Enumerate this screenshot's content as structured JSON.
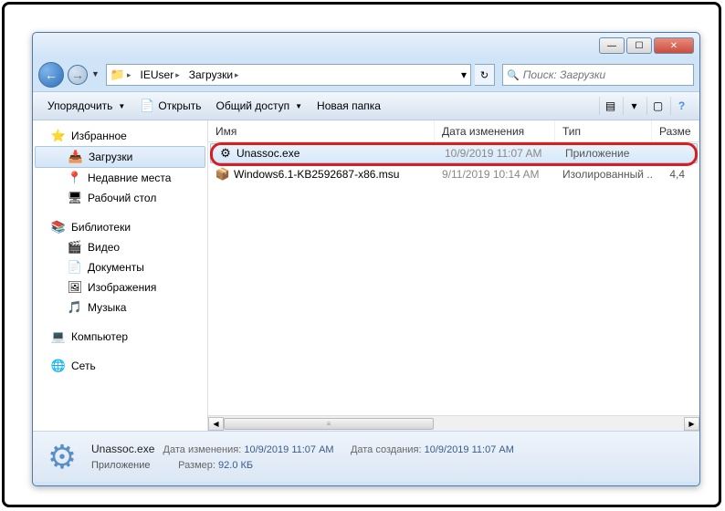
{
  "titlebar": {
    "min": "—",
    "max": "☐",
    "close": "✕"
  },
  "nav": {
    "back": "←",
    "fwd": "→",
    "drop": "▼",
    "refresh": "↻"
  },
  "breadcrumb": {
    "root_icon": "📁",
    "seg1": "IEUser",
    "seg2": "Загрузки",
    "arrow": "▸",
    "end_drop": "▾"
  },
  "search": {
    "icon": "🔍",
    "placeholder": "Поиск: Загрузки"
  },
  "toolbar": {
    "organize": "Упорядочить",
    "open_icon": "📄",
    "open": "Открыть",
    "share": "Общий доступ",
    "new_folder": "Новая папка",
    "view1": "▤",
    "view2": "▾",
    "preview": "▢",
    "help": "?"
  },
  "sidebar": {
    "favorites": {
      "icon": "⭐",
      "label": "Избранное"
    },
    "downloads": {
      "icon": "📥",
      "label": "Загрузки"
    },
    "recent": {
      "icon": "📍",
      "label": "Недавние места"
    },
    "desktop": {
      "icon": "🖥",
      "label": "Рабочий стол"
    },
    "libraries": {
      "icon": "📚",
      "label": "Библиотеки"
    },
    "videos": {
      "icon": "🎬",
      "label": "Видео"
    },
    "documents": {
      "icon": "📄",
      "label": "Документы"
    },
    "pictures": {
      "icon": "🖼",
      "label": "Изображения"
    },
    "music": {
      "icon": "🎵",
      "label": "Музыка"
    },
    "computer": {
      "icon": "💻",
      "label": "Компьютер"
    },
    "network": {
      "icon": "🌐",
      "label": "Сеть"
    }
  },
  "columns": {
    "name": "Имя",
    "date": "Дата изменения",
    "type": "Тип",
    "size": "Разме"
  },
  "files": [
    {
      "icon": "⚙",
      "name": "Unassoc.exe",
      "date": "10/9/2019 11:07 AM",
      "type": "Приложение",
      "size": ""
    },
    {
      "icon": "📦",
      "name": "Windows6.1-KB2592687-x86.msu",
      "date": "9/11/2019 10:14 AM",
      "type": "Изолированный ...",
      "size": "4,4"
    }
  ],
  "details": {
    "icon": "⚙",
    "filename": "Unassoc.exe",
    "app_label": "Приложение",
    "date_label": "Дата изменения:",
    "date_value": "10/9/2019 11:07 AM",
    "size_label": "Размер:",
    "size_value": "92.0 КБ",
    "created_label": "Дата создания:",
    "created_value": "10/9/2019 11:07 AM"
  }
}
